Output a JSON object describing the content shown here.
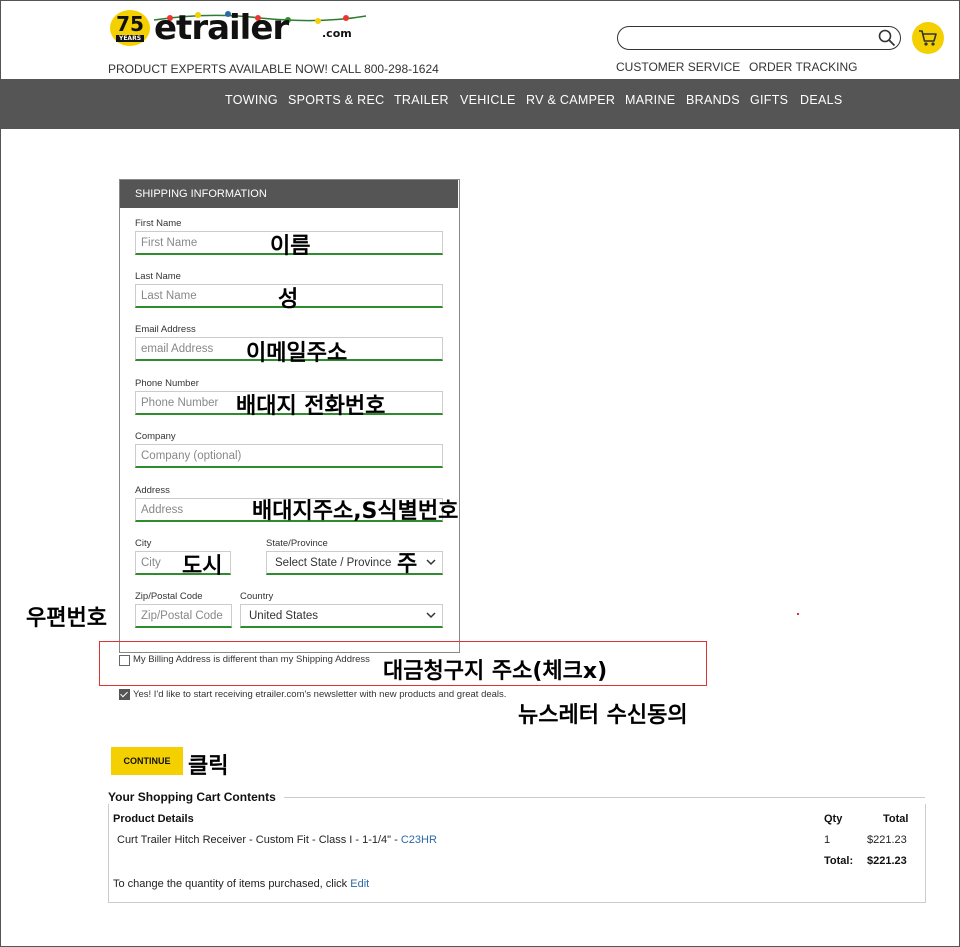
{
  "header": {
    "logo_years_number": "75",
    "logo_years_label": "YEARS",
    "logo_text": "etrailer",
    "logo_suffix": ".com",
    "tagline": "PRODUCT EXPERTS AVAILABLE NOW! CALL 800-298-1624",
    "links": [
      "CUSTOMER SERVICE",
      "ORDER TRACKING"
    ]
  },
  "nav": [
    "TOWING",
    "SPORTS & REC",
    "TRAILER",
    "VEHICLE",
    "RV & CAMPER",
    "MARINE",
    "BRANDS",
    "GIFTS",
    "DEALS"
  ],
  "form": {
    "title": "SHIPPING INFORMATION",
    "first_name": {
      "label": "First Name",
      "placeholder": "First Name"
    },
    "last_name": {
      "label": "Last Name",
      "placeholder": "Last Name"
    },
    "email": {
      "label": "Email Address",
      "placeholder": "email Address"
    },
    "phone": {
      "label": "Phone Number",
      "placeholder": "Phone Number"
    },
    "company": {
      "label": "Company",
      "placeholder": "Company (optional)"
    },
    "address": {
      "label": "Address",
      "placeholder": "Address"
    },
    "city": {
      "label": "City",
      "placeholder": "City"
    },
    "state": {
      "label": "State/Province",
      "value": "Select State / Province"
    },
    "zip": {
      "label": "Zip/Postal Code",
      "placeholder": "Zip/Postal Code"
    },
    "country": {
      "label": "Country",
      "value": "United States"
    },
    "billing_checkbox": {
      "label": "My Billing Address is different than my Shipping Address",
      "checked": false
    },
    "newsletter_checkbox": {
      "label": "Yes! I'd like to start receiving etrailer.com's newsletter with new products and great deals.",
      "checked": true
    },
    "continue_label": "CONTINUE"
  },
  "annotations": {
    "first_name": "이름",
    "last_name": "성",
    "email": "이메일주소",
    "phone": "배대지 전화번호",
    "address": "배대지주소,S식별번호",
    "city": "도시",
    "state": "주",
    "zip": "우편번호",
    "billing": "대금청구지 주소(체크x)",
    "newsletter": "뉴스레터 수신동의",
    "continue": "클릭"
  },
  "cart": {
    "title": "Your Shopping Cart Contents",
    "headers": {
      "details": "Product Details",
      "qty": "Qty",
      "total": "Total"
    },
    "item": {
      "name": "Curt Trailer Hitch Receiver - Custom Fit - Class I - 1-1/4\" - ",
      "code": "C23HR",
      "qty": "1",
      "total": "$221.23"
    },
    "total_label": "Total:",
    "total_value": "$221.23",
    "change_text": "To change the quantity of items purchased, click ",
    "edit_label": "Edit"
  },
  "colors": {
    "accent": "#f4d000",
    "nav_bg": "#555555",
    "field_underline": "#2e8b2e",
    "highlight_box": "#dd3333",
    "link": "#2a6aa8"
  },
  "icons": {
    "search": "magnifier-icon",
    "cart": "shopping-cart-icon"
  }
}
